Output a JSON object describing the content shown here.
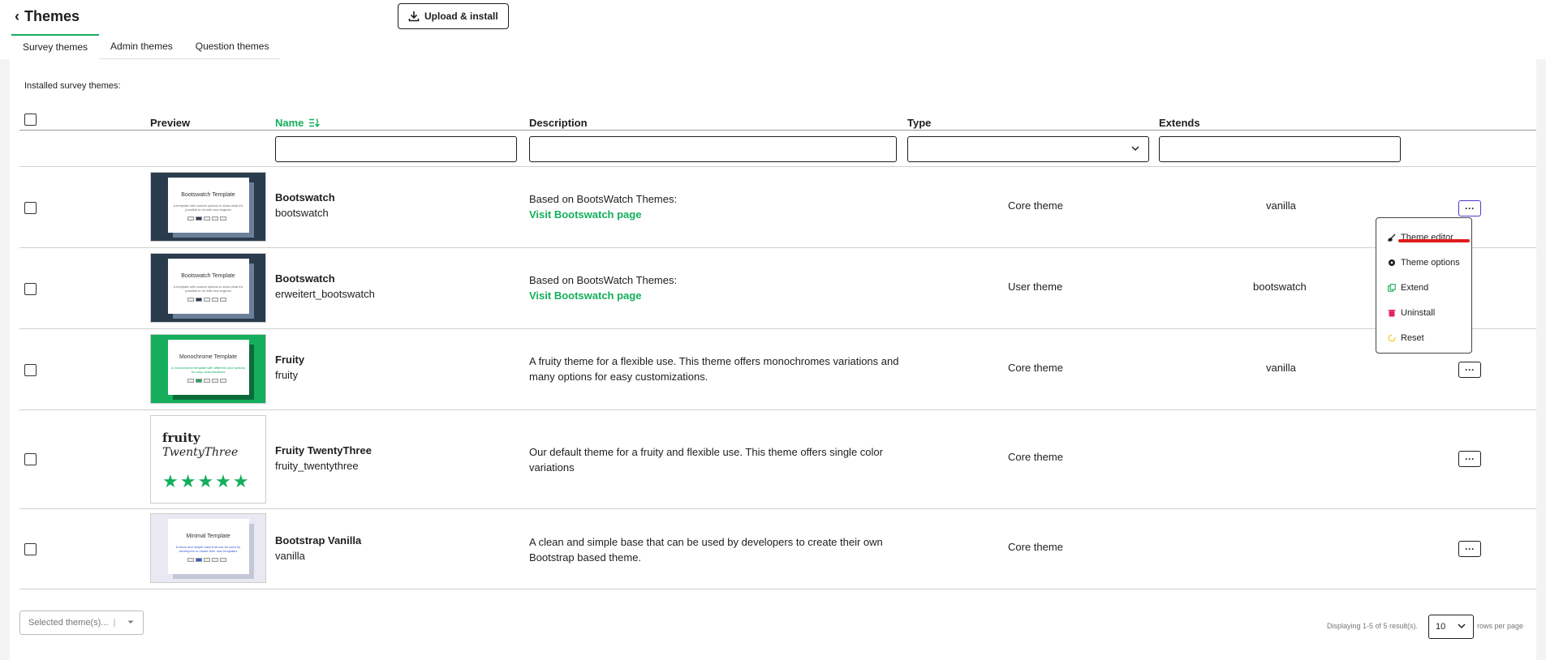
{
  "header": {
    "back_label": "Themes",
    "upload_label": "Upload & install"
  },
  "tabs": [
    {
      "label": "Survey themes",
      "active": true
    },
    {
      "label": "Admin themes",
      "active": false
    },
    {
      "label": "Question themes",
      "active": false
    }
  ],
  "installed_label": "Installed survey themes:",
  "columns": {
    "preview": "Preview",
    "name": "Name",
    "description": "Description",
    "type": "Type",
    "extends": "Extends"
  },
  "rows": [
    {
      "thumb": {
        "title": "Bootswatch Template",
        "sub": "A template with custom options to show what it's possible to do with new engines",
        "style": "dark"
      },
      "name": "Bootswatch",
      "slug": "bootswatch",
      "desc": "Based on BootsWatch Themes:",
      "link": "Visit Bootswatch page",
      "type": "Core theme",
      "extends": "vanilla"
    },
    {
      "thumb": {
        "title": "Bootswatch Template",
        "sub": "A template with custom options to show what it's possible to do with new engines",
        "style": "dark"
      },
      "name": "Bootswatch",
      "slug": "erweitert_bootswatch",
      "desc": "Based on BootsWatch Themes:",
      "link": "Visit Bootswatch page",
      "type": "User theme",
      "extends": "bootswatch"
    },
    {
      "thumb": {
        "title": "Monochrome Template",
        "sub": "A monochrome template with different color options for easy customizations",
        "style": "green"
      },
      "name": "Fruity",
      "slug": "fruity",
      "desc": "A fruity theme for a flexible use. This theme offers monochromes variations and many options for easy customizations.",
      "type": "Core theme",
      "extends": "vanilla"
    },
    {
      "thumb": {
        "title": "fruity",
        "sub": "TwentyThree",
        "style": "fruity23"
      },
      "name": "Fruity TwentyThree",
      "slug": "fruity_twentythree",
      "desc": "Our default theme for a fruity and flexible use. This theme offers single color variations",
      "type": "Core theme",
      "extends": ""
    },
    {
      "thumb": {
        "title": "Minimal Template",
        "sub": "A clean and simple base that can be used by developers to create their own templates",
        "style": "light"
      },
      "name": "Bootstrap Vanilla",
      "slug": "vanilla",
      "desc": "A clean and simple base that can be used by developers to create their own Bootstrap based theme.",
      "type": "Core theme",
      "extends": ""
    }
  ],
  "thumb_pages": [
    "1",
    "2",
    "3",
    "4",
    "5"
  ],
  "menu": [
    {
      "label": "Theme editor",
      "icon": "brush-icon",
      "color": "#1e1e1e"
    },
    {
      "label": "Theme options",
      "icon": "settings-icon",
      "color": "#1e1e1e"
    },
    {
      "label": "Extend",
      "icon": "copy-icon",
      "color": "#14ae5c"
    },
    {
      "label": "Uninstall",
      "icon": "trash-icon",
      "color": "#e0245e"
    },
    {
      "label": "Reset",
      "icon": "reset-icon",
      "color": "#f5c518"
    }
  ],
  "footer": {
    "selected_placeholder": "Selected theme(s)...",
    "displaying": "Displaying 1-5 of 5 result(s).",
    "page_size": "10",
    "rows_per_page": "rows per page"
  },
  "colors": {
    "accent": "#14ae5c",
    "danger": "#e01b1b",
    "focus": "#4b3bd4"
  }
}
